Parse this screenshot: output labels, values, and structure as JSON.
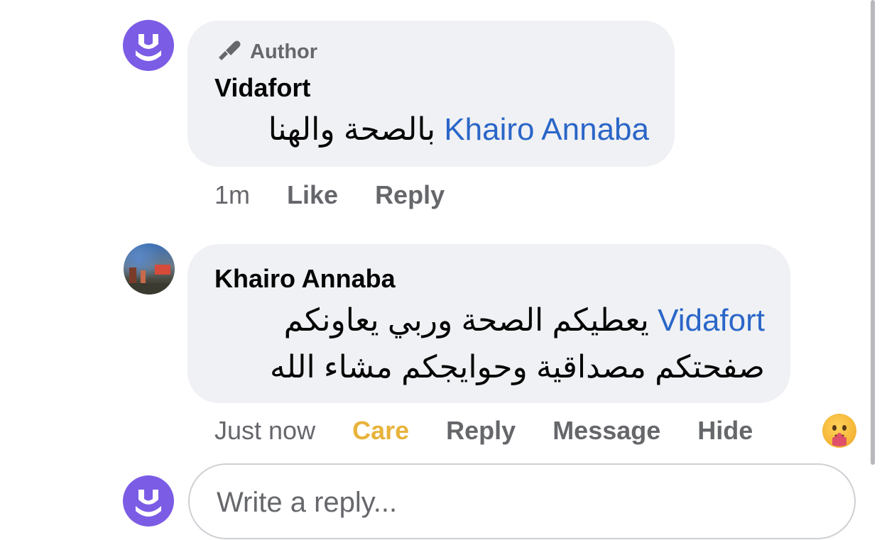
{
  "comments": [
    {
      "badge": "Author",
      "author": "Vidafort",
      "mention": "Khairo Annaba",
      "text": "بالصحة والهنا",
      "time": "1m",
      "actions": [
        "Like",
        "Reply"
      ]
    },
    {
      "author": "Khairo Annaba",
      "mention": "Vidafort",
      "text_line1": "يعطيكم الصحة وربي يعاونكم",
      "text_line2": "صفحتكم مصداقية وحوايجكم مشاء الله",
      "time": "Just now",
      "reaction_label": "Care",
      "actions": [
        "Reply",
        "Message",
        "Hide"
      ]
    }
  ],
  "reply_input": {
    "placeholder": "Write a reply...",
    "value": ""
  },
  "colors": {
    "bubble_bg": "#f0f1f4",
    "mention": "#2a66c8",
    "care": "#e8b33c",
    "brand_avatar": "#7b5ce5",
    "meta_text": "#65676b"
  }
}
